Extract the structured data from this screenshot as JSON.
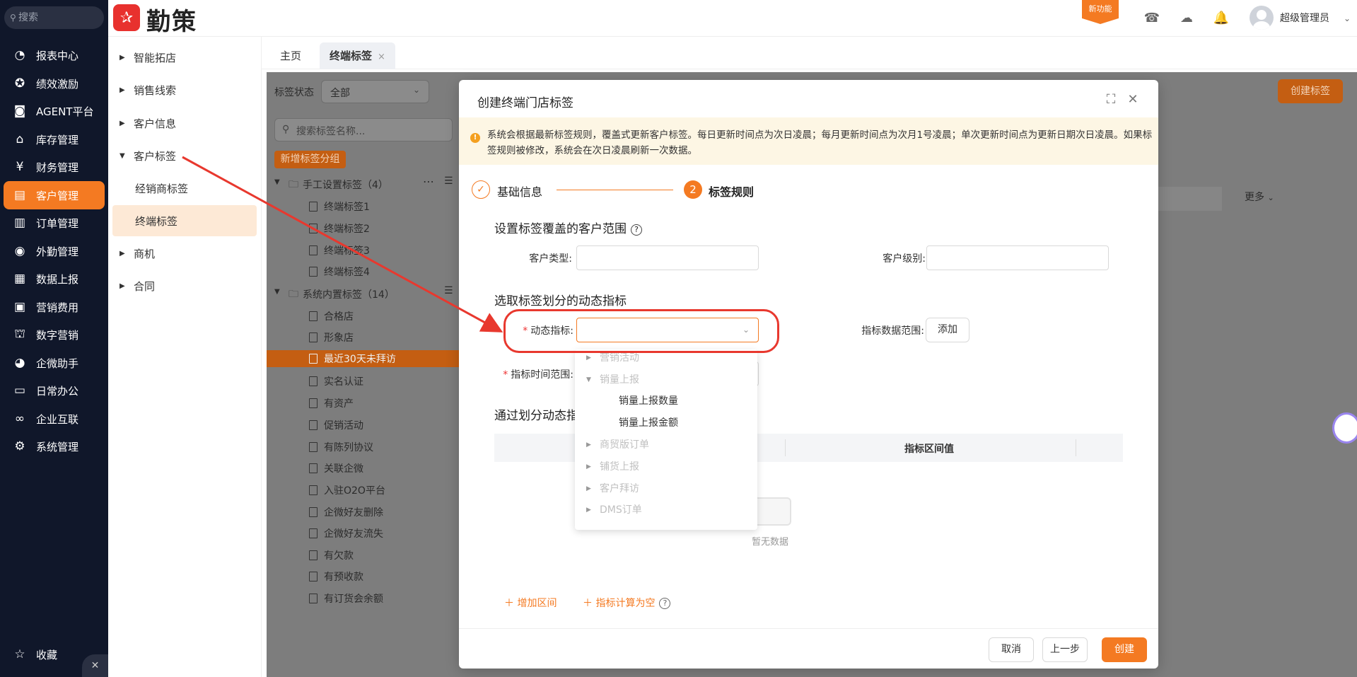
{
  "nav": {
    "search_placeholder": "搜索",
    "items": [
      {
        "label": "报表中心",
        "icon": "pie-chart-icon"
      },
      {
        "label": "绩效激励",
        "icon": "medal-icon"
      },
      {
        "label": "AGENT平台",
        "icon": "robot-icon"
      },
      {
        "label": "库存管理",
        "icon": "warehouse-icon"
      },
      {
        "label": "财务管理",
        "icon": "yen-icon"
      },
      {
        "label": "客户管理",
        "icon": "customer-icon"
      },
      {
        "label": "订单管理",
        "icon": "order-icon"
      },
      {
        "label": "外勤管理",
        "icon": "location-icon"
      },
      {
        "label": "数据上报",
        "icon": "report-icon"
      },
      {
        "label": "营销费用",
        "icon": "expense-icon"
      },
      {
        "label": "数字营销",
        "icon": "shop-icon"
      },
      {
        "label": "企微助手",
        "icon": "wecom-icon"
      },
      {
        "label": "日常办公",
        "icon": "briefcase-icon"
      },
      {
        "label": "企业互联",
        "icon": "link-icon"
      },
      {
        "label": "系统管理",
        "icon": "gear-icon"
      }
    ],
    "active_index": 5,
    "favorites": "收藏"
  },
  "topbar": {
    "brand": "勤策",
    "new_feature": "新功能",
    "user": "超级管理员"
  },
  "submenu": {
    "items": [
      {
        "label": "智能拓店"
      },
      {
        "label": "销售线索"
      },
      {
        "label": "客户信息"
      },
      {
        "label": "客户标签"
      },
      {
        "label": "经销商标签"
      },
      {
        "label": "终端标签"
      },
      {
        "label": "商机"
      },
      {
        "label": "合同"
      }
    ]
  },
  "tabs": {
    "home": "主页",
    "current": "终端标签",
    "close": "×"
  },
  "page": {
    "status_label": "标签状态",
    "status_value": "全部",
    "search_placeholder": "搜索标签名称...",
    "add_group": "新增标签分组",
    "create_tag": "创建标签",
    "more": "更多",
    "manual_group": "手工设置标签（4）",
    "manual_items": [
      "终端标签1",
      "终端标签2",
      "终端标签3",
      "终端标签4"
    ],
    "system_group": "系统内置标签（14）",
    "system_items": [
      "合格店",
      "形象店",
      "最近30天未拜访",
      "实名认证",
      "有资产",
      "促销活动",
      "有陈列协议",
      "关联企微",
      "入驻O2O平台",
      "企微好友删除",
      "企微好友流失",
      "有欠款",
      "有预收款",
      "有订货会余额"
    ]
  },
  "dialog": {
    "title": "创建终端门店标签",
    "notice": "系统会根据最新标签规则，覆盖式更新客户标签。每日更新时间点为次日凌晨；每月更新时间点为次月1号凌晨；单次更新时间点为更新日期次日凌晨。如果标签规则被修改，系统会在次日凌晨刷新一次数据。",
    "step1": "基础信息",
    "step2_num": "2",
    "step2": "标签规则",
    "sec1": "设置标签覆盖的客户范围",
    "customer_type": "客户类型:",
    "customer_level": "客户级别:",
    "sec2": "选取标签划分的动态指标",
    "dynamic_indicator": "动态指标:",
    "indicator_range": "指标数据范围:",
    "add": "添加",
    "time_range": "指标时间范围:",
    "sec3": "通过划分动态指",
    "col_interval": "指标区间值",
    "empty": "暂无数据",
    "add_interval": "增加区间",
    "null_calc": "指标计算为空",
    "cancel": "取消",
    "prev": "上一步",
    "create": "创建"
  },
  "dropdown": {
    "items": [
      {
        "label": "营销活动",
        "type": "group",
        "expanded": false
      },
      {
        "label": "销量上报",
        "type": "group",
        "expanded": true
      },
      {
        "label": "销量上报数量",
        "type": "leaf"
      },
      {
        "label": "销量上报金额",
        "type": "leaf"
      },
      {
        "label": "商贸版订单",
        "type": "group",
        "expanded": false
      },
      {
        "label": "铺货上报",
        "type": "group",
        "expanded": false
      },
      {
        "label": "客户拜访",
        "type": "group",
        "expanded": false
      },
      {
        "label": "DMS订单",
        "type": "group",
        "expanded": false
      }
    ]
  },
  "colors": {
    "accent": "#f47a22",
    "nav_bg": "#10172a",
    "callout": "#e8382e"
  }
}
